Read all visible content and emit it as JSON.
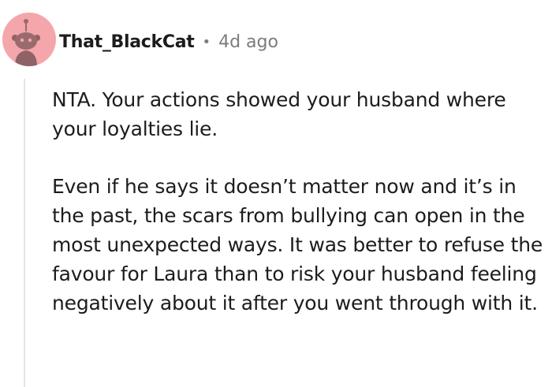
{
  "comment": {
    "author": "That_BlackCat",
    "separator": "•",
    "time": "4d ago",
    "avatar_icon": "snoo-avatar-icon",
    "avatar_bg": "#f4a6aa",
    "paragraphs": [
      "NTA. Your actions showed your husband where your loyalties lie.",
      "Even if he says it doesn’t matter now and it’s in the past, the scars from bullying can open in the most unexpected ways. It was better to refuse the favour for Laura than to risk your husband feeling negatively about it after you went through with it."
    ]
  }
}
